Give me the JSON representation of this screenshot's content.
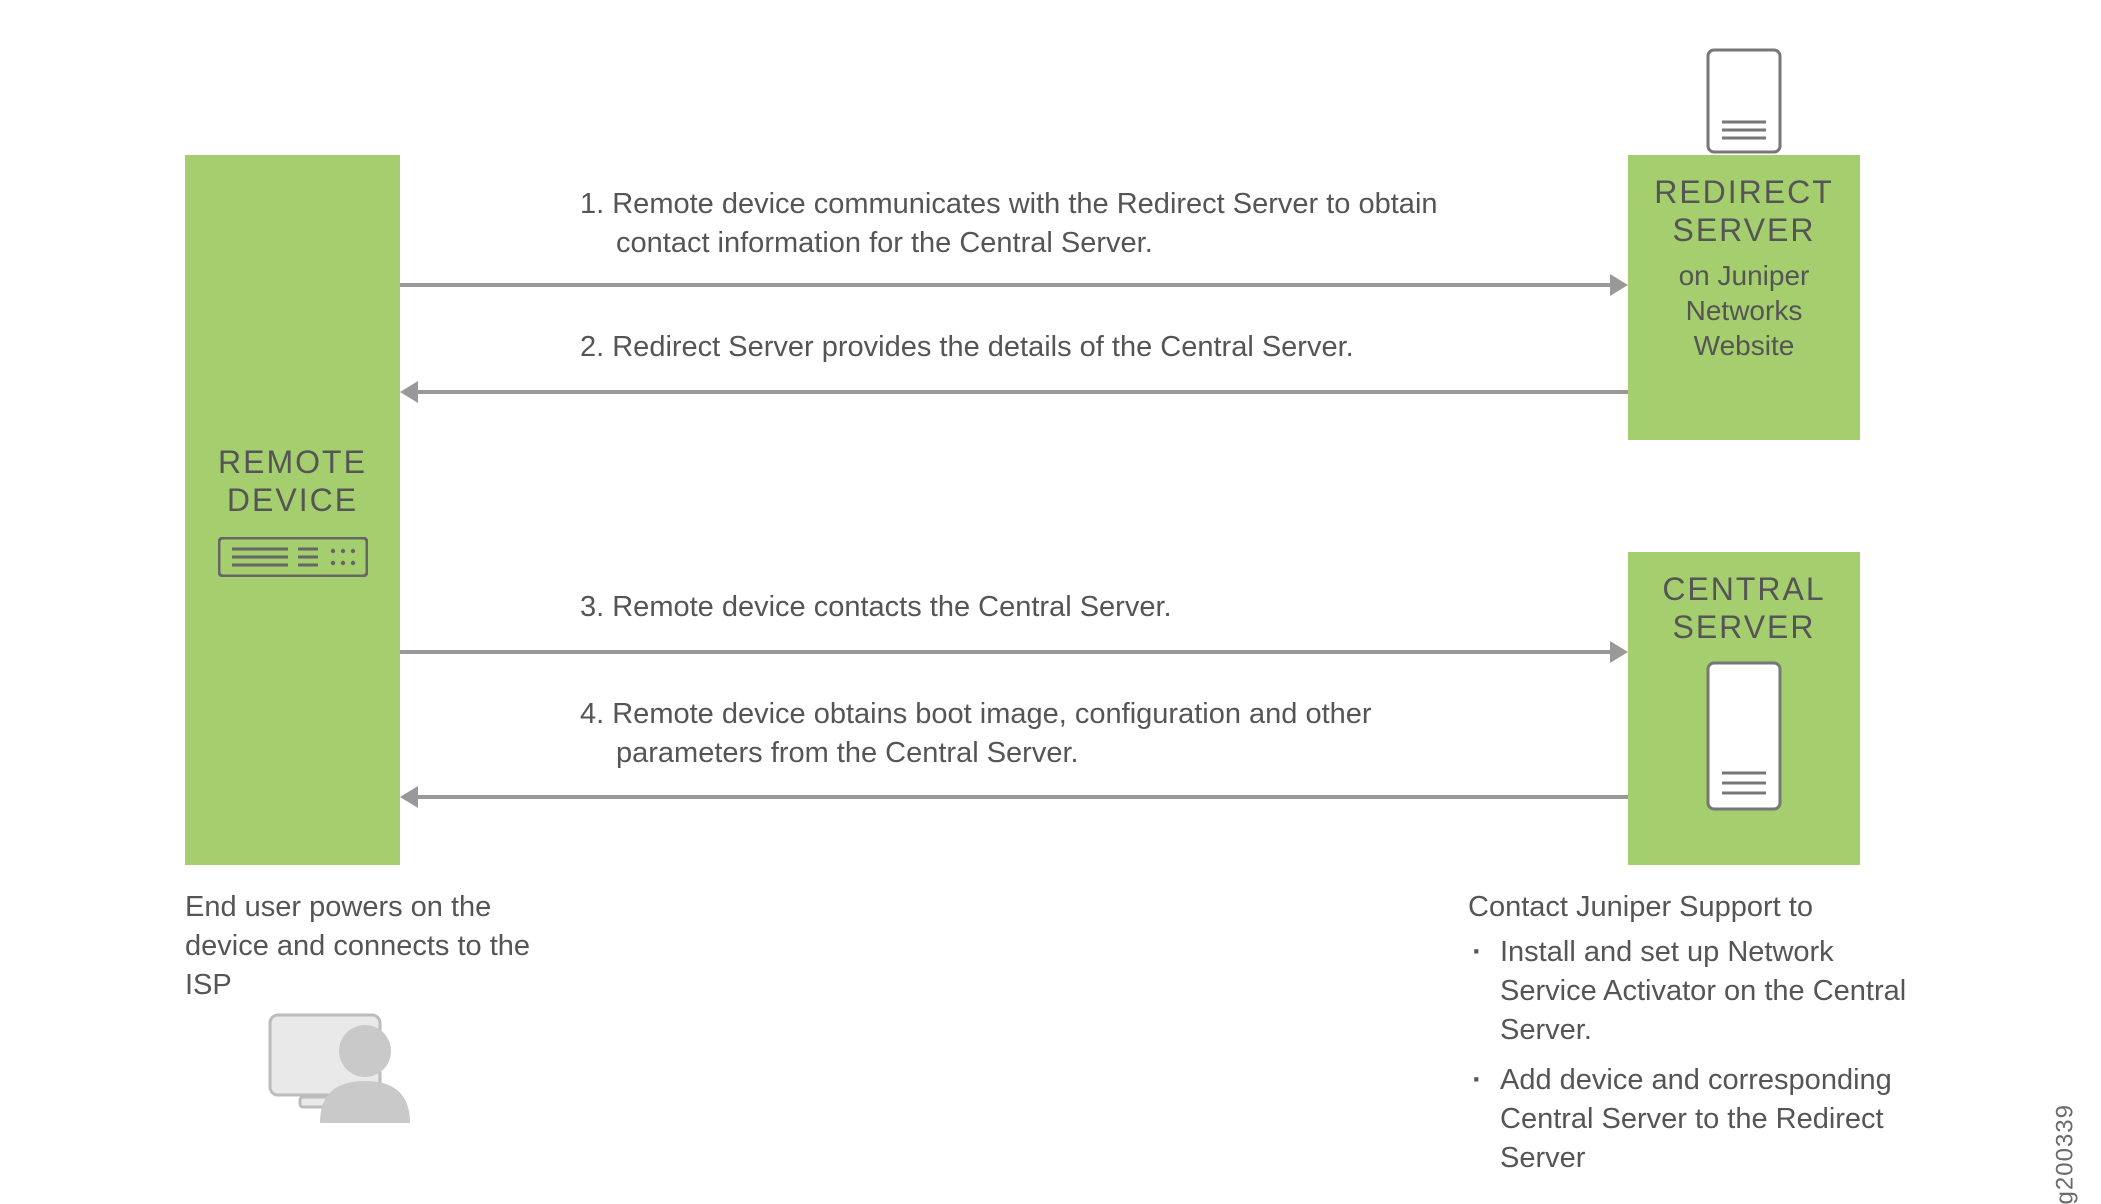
{
  "diagram_id": "g200339",
  "boxes": {
    "remote": {
      "title1": "REMOTE",
      "title2": "DEVICE"
    },
    "redirect": {
      "title1": "REDIRECT",
      "title2": "SERVER",
      "sub1": "on Juniper",
      "sub2": "Networks",
      "sub3": "Website"
    },
    "central": {
      "title1": "CENTRAL",
      "title2": "SERVER"
    }
  },
  "flows": {
    "s1": "1.  Remote device communicates with the Redirect Server to obtain contact information for the Central Server.",
    "s2": "2. Redirect Server provides the details of the Central Server.",
    "s3": "3. Remote device contacts the Central Server.",
    "s4": "4. Remote device obtains boot image, configuration and other parameters from the Central Server."
  },
  "captions": {
    "end_user": "End user powers on the device and connects to the ISP",
    "support_intro": "Contact Juniper Support to",
    "support_b1": "Install and set up Network Service Activator on the Central Server.",
    "support_b2": "Add device and corresponding Central Server to the Redirect Server"
  },
  "icons": {
    "remote_device": "rack-device-icon",
    "server": "server-tower-icon",
    "user": "user-with-monitor-icon"
  }
}
